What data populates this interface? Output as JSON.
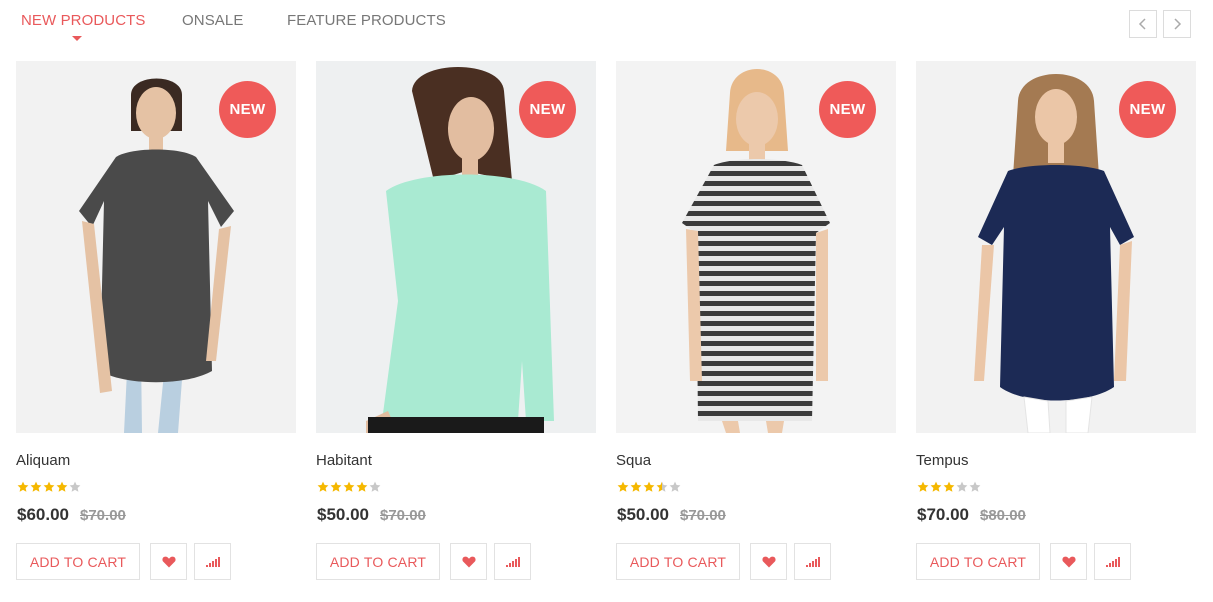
{
  "tabs": [
    {
      "label": "NEW PRODUCTS",
      "active": true
    },
    {
      "label": "ONSALE",
      "active": false
    },
    {
      "label": "FEATURE PRODUCTS",
      "active": false
    }
  ],
  "nav": {
    "prev_icon": "chevron-left-icon",
    "next_icon": "chevron-right-icon"
  },
  "colors": {
    "accent": "#e9595b",
    "badge": "#ef5a59",
    "star_on": "#f5b800",
    "star_off": "#c8c8c8"
  },
  "products": [
    {
      "name": "Aliquam",
      "badge": "NEW",
      "rating": 4,
      "price": "$60.00",
      "old_price": "$70.00",
      "add_to_cart": "ADD TO CART",
      "garment_color": "#4a4a4a"
    },
    {
      "name": "Habitant",
      "badge": "NEW",
      "rating": 4,
      "price": "$50.00",
      "old_price": "$70.00",
      "add_to_cart": "ADD TO CART",
      "garment_color": "#a9ead2"
    },
    {
      "name": "Squa",
      "badge": "NEW",
      "rating": 3.5,
      "price": "$50.00",
      "old_price": "$70.00",
      "add_to_cart": "ADD TO CART",
      "garment_color": "striped"
    },
    {
      "name": "Tempus",
      "badge": "NEW",
      "rating": 3,
      "price": "$70.00",
      "old_price": "$80.00",
      "add_to_cart": "ADD TO CART",
      "garment_color": "#1c2a55"
    }
  ]
}
